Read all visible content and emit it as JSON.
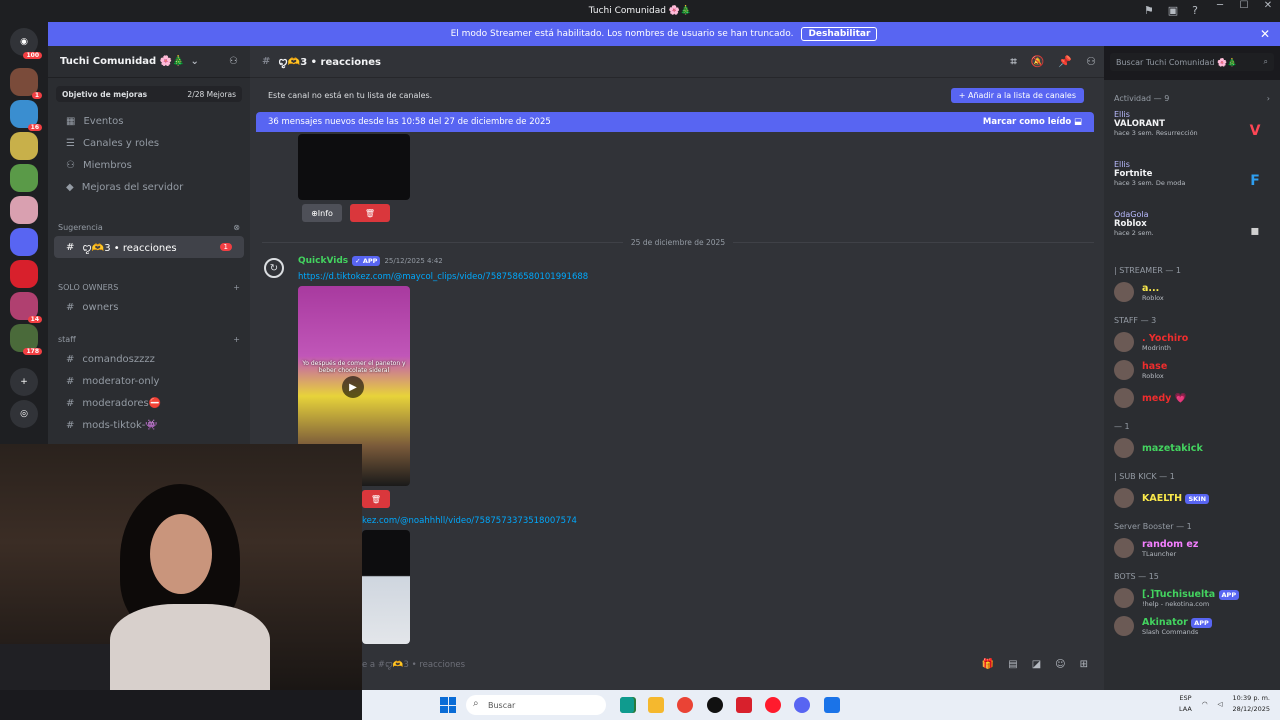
{
  "titlebar": {
    "title": "Tuchi Comunidad 🌸🎄"
  },
  "streamer_bar": {
    "message": "El modo Streamer está habilitado. Los nombres de usuario se han truncado.",
    "button": "Deshabilitar"
  },
  "guilds": [
    {
      "badge": "100",
      "color": "#e0506a"
    },
    {
      "badge": "1",
      "color": "#7a4b3a"
    },
    {
      "badge": "16",
      "color": "#3a8ed0"
    },
    {
      "badge": "",
      "color": "#c8b04a"
    },
    {
      "badge": "",
      "color": "#5a9a48"
    },
    {
      "badge": "",
      "color": "#d9a0b0"
    },
    {
      "badge": "",
      "color": "#5865f2"
    },
    {
      "badge": "",
      "color": "#d8202c"
    },
    {
      "badge": "14",
      "color": "#b04070"
    },
    {
      "badge": "178",
      "color": "#4a6a3a"
    }
  ],
  "server": {
    "name": "Tuchi Comunidad 🌸🎄",
    "boost_label": "Objetivo de mejoras",
    "boost_value": "2/28 Mejoras"
  },
  "nav_items": [
    "Eventos",
    "Canales y roles",
    "Miembros",
    "Mejoras del servidor"
  ],
  "categories": {
    "sugerencia": "Sugerencia",
    "solo_owners": "SOLO OWNERS",
    "staff": "staff"
  },
  "channels": {
    "active": "ꨄ︎🫶3 • reacciones",
    "active_badge": "1",
    "owners": "owners",
    "staff": [
      "comandoszzzz",
      "moderator-only",
      "moderadores⛔",
      "mods-tiktok-👾"
    ]
  },
  "chat": {
    "channel_title": "ꨄ︎🫶3 • reacciones",
    "notice": "Este canal no está en tu lista de canales.",
    "add_button": "Añadir a la lista de canales",
    "new_messages": "36 mensajes nuevos desde las 10:58 del 27 de diciembre de 2025",
    "mark_read": "Marcar como leído",
    "info_button": "Info",
    "date_divider": "25 de diciembre de 2025",
    "author": "QuickVids",
    "app_badge": "APP",
    "timestamp": "25/12/2025 4:42",
    "link1": "https://d.tiktokez.com/@maycol_clips/video/7587586580101991688",
    "caption": "Yo después de comer el paneton y beber chocolate sideral",
    "link2": "kez.com/@noahhhll/video/7587573373518007574",
    "compose_placeholder": "e a #ꨄ︎🫶3 • reacciones"
  },
  "search": {
    "placeholder": "Buscar Tuchi Comunidad 🌸🎄"
  },
  "members": {
    "activity_header": "Actividad — 9",
    "activities": [
      {
        "user": "Ellis",
        "game": "VALORANT",
        "time": "hace 3 sem.",
        "extra": "Resurrección",
        "glyph": "V",
        "color": "#ff4655"
      },
      {
        "user": "Ellis",
        "game": "Fortnite",
        "time": "hace 3 sem.",
        "extra": "De moda",
        "glyph": "F",
        "color": "#2e9ef0"
      },
      {
        "user": "OdaGola",
        "game": "Roblox",
        "time": "hace 2 sem.",
        "extra": "",
        "glyph": "▪",
        "color": "#d0d0d0"
      }
    ],
    "groups": [
      {
        "header": "| STREAMER — 1",
        "members": [
          {
            "name": "a...",
            "status": "Roblox",
            "color": "#f9e84b"
          }
        ]
      },
      {
        "header": "STAFF — 3",
        "members": [
          {
            "name": ". Yochiro",
            "status": "Modrinth",
            "color": "#ef2d2d"
          },
          {
            "name": "hase",
            "status": "Roblox",
            "color": "#ef2d2d"
          },
          {
            "name": "medy 💗",
            "status": "",
            "color": "#ef2d2d"
          }
        ]
      },
      {
        "header": "— 1",
        "members": [
          {
            "name": "mazetakick",
            "status": "",
            "color": "#43d35f"
          }
        ]
      },
      {
        "header": "| SUB KICK — 1",
        "members": [
          {
            "name": "KAELTH",
            "status": "",
            "color": "#f9e84b",
            "tag": "SKIN"
          }
        ]
      },
      {
        "header": "Server Booster — 1",
        "members": [
          {
            "name": "random ez",
            "status": "TLauncher",
            "color": "#f47fff"
          }
        ]
      },
      {
        "header": "BOTS — 15",
        "members": [
          {
            "name": "[.]Tuchisuelta",
            "status": "!help - nekotina.com",
            "color": "#43d35f",
            "tag": "APP"
          },
          {
            "name": "Akinator",
            "status": "Slash Commands",
            "color": "#43d35f",
            "tag": "APP"
          }
        ]
      }
    ]
  },
  "taskbar": {
    "search": "Buscar",
    "lang1": "ESP",
    "lang2": "LAA",
    "time": "10:39 p. m.",
    "date": "28/12/2025"
  }
}
